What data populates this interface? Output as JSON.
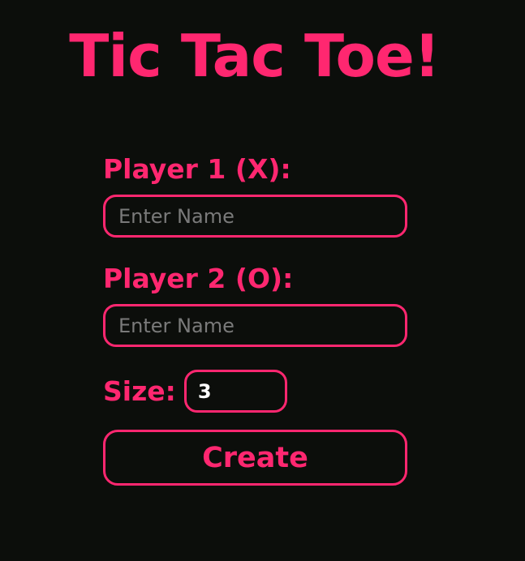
{
  "page": {
    "title": "Tic Tac Toe!"
  },
  "form": {
    "player1": {
      "label": "Player 1 (X):",
      "value": "",
      "placeholder": "Enter Name"
    },
    "player2": {
      "label": "Player 2 (O):",
      "value": "",
      "placeholder": "Enter Name"
    },
    "size": {
      "label": "Size:",
      "value": "3"
    },
    "create_label": "Create"
  },
  "colors": {
    "accent": "#ff2770",
    "background": "#0c0e0b",
    "placeholder": "#7a7a7a"
  }
}
